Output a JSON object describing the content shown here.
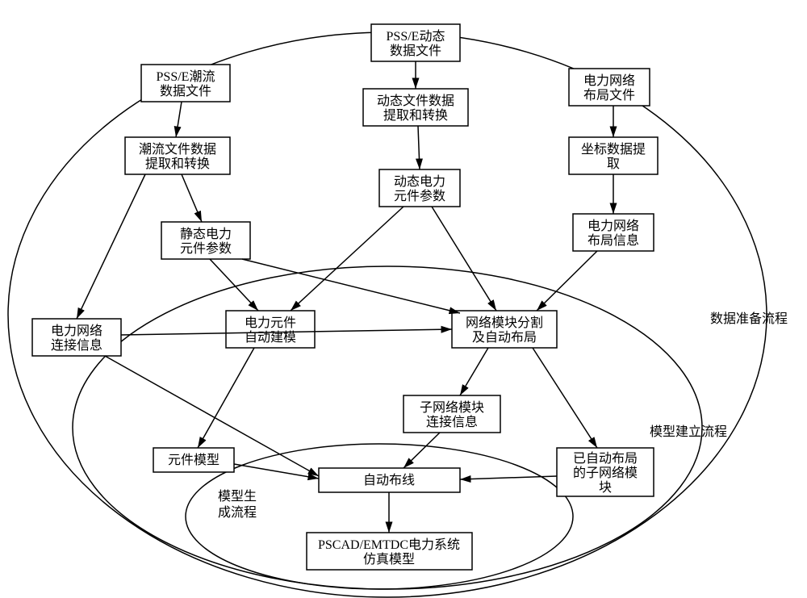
{
  "nodes": {
    "n1": {
      "l1": "PSS/E潮流",
      "l2": "数据文件"
    },
    "n2": {
      "l1": "PSS/E动态",
      "l2": "数据文件"
    },
    "n3": {
      "l1": "电力网络",
      "l2": "布局文件"
    },
    "n4": {
      "l1": "潮流文件数据",
      "l2": "提取和转换"
    },
    "n5": {
      "l1": "动态文件数据",
      "l2": "提取和转换"
    },
    "n6": {
      "l1": "坐标数据提",
      "l2": "取"
    },
    "n7": {
      "l1": "静态电力",
      "l2": "元件参数"
    },
    "n8": {
      "l1": "动态电力",
      "l2": "元件参数"
    },
    "n9": {
      "l1": "电力网络",
      "l2": "布局信息"
    },
    "n10": {
      "l1": "电力元件",
      "l2": "自动建模"
    },
    "n11": {
      "l1": "网络模块分割",
      "l2": "及自动布局"
    },
    "n12": {
      "l1": "电力网络",
      "l2": "连接信息"
    },
    "n13": {
      "l1": "子网络模块",
      "l2": "连接信息"
    },
    "n14": {
      "l1": "元件模型"
    },
    "n15": {
      "l1": "自动布线"
    },
    "n16": {
      "l1": "已自动布局",
      "l2": "的子网络模",
      "l3": "块"
    },
    "n17": {
      "l1": "PSCAD/EMTDC电力系统",
      "l2": "仿真模型"
    }
  },
  "ring_labels": {
    "outer": "数据准备流程",
    "middle": "模型建立流程",
    "inner1": "模型生",
    "inner2": "成流程"
  }
}
